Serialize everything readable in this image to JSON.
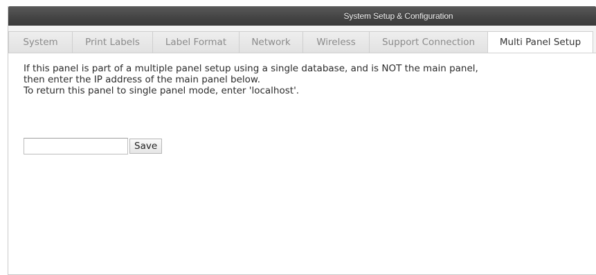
{
  "window": {
    "title": "System Setup & Configuration"
  },
  "tabs": [
    {
      "label": "System",
      "active": false
    },
    {
      "label": "Print Labels",
      "active": false
    },
    {
      "label": "Label Format",
      "active": false
    },
    {
      "label": "Network",
      "active": false
    },
    {
      "label": "Wireless",
      "active": false
    },
    {
      "label": "Support Connection",
      "active": false
    },
    {
      "label": "Multi Panel Setup",
      "active": true
    }
  ],
  "panel": {
    "instruction_line_1": "If this panel is part of a multiple panel setup using a single database, and is NOT the main panel,",
    "instruction_line_2": "then enter the IP address of the main panel below.",
    "instruction_line_3": "To return this panel to single panel mode, enter 'localhost'.",
    "ip_field_value": "",
    "ip_field_placeholder": "",
    "save_label": "Save"
  },
  "colors": {
    "titlebar": "#454545",
    "tab_inactive_text": "#8a8a8a",
    "tab_active_text": "#333333"
  }
}
